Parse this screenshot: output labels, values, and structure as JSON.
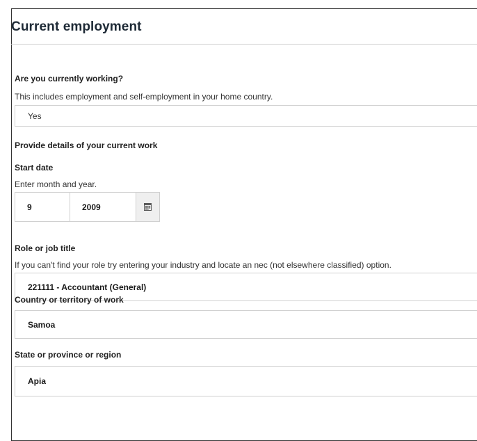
{
  "section": {
    "title": "Current employment"
  },
  "working": {
    "label": "Are you currently working?",
    "hint": "This includes employment and self-employment in your home country.",
    "value": "Yes"
  },
  "work_details": {
    "heading": "Provide details of your current work"
  },
  "start_date": {
    "label": "Start date",
    "hint": "Enter month and year.",
    "month": "9",
    "year": "2009",
    "calendar_icon": "calendar-icon"
  },
  "role": {
    "label": "Role or job title",
    "hint": "If you can't find your role try entering your industry and locate an nec (not elsewhere classified) option.",
    "value": "221111 - Accountant (General)"
  },
  "country": {
    "label": "Country or territory of work",
    "value": "Samoa"
  },
  "state": {
    "label": "State or province or region",
    "value": "Apia"
  },
  "colors": {
    "border": "#d0d0d0",
    "title": "#1e2a36",
    "panel_border": "#333333"
  }
}
